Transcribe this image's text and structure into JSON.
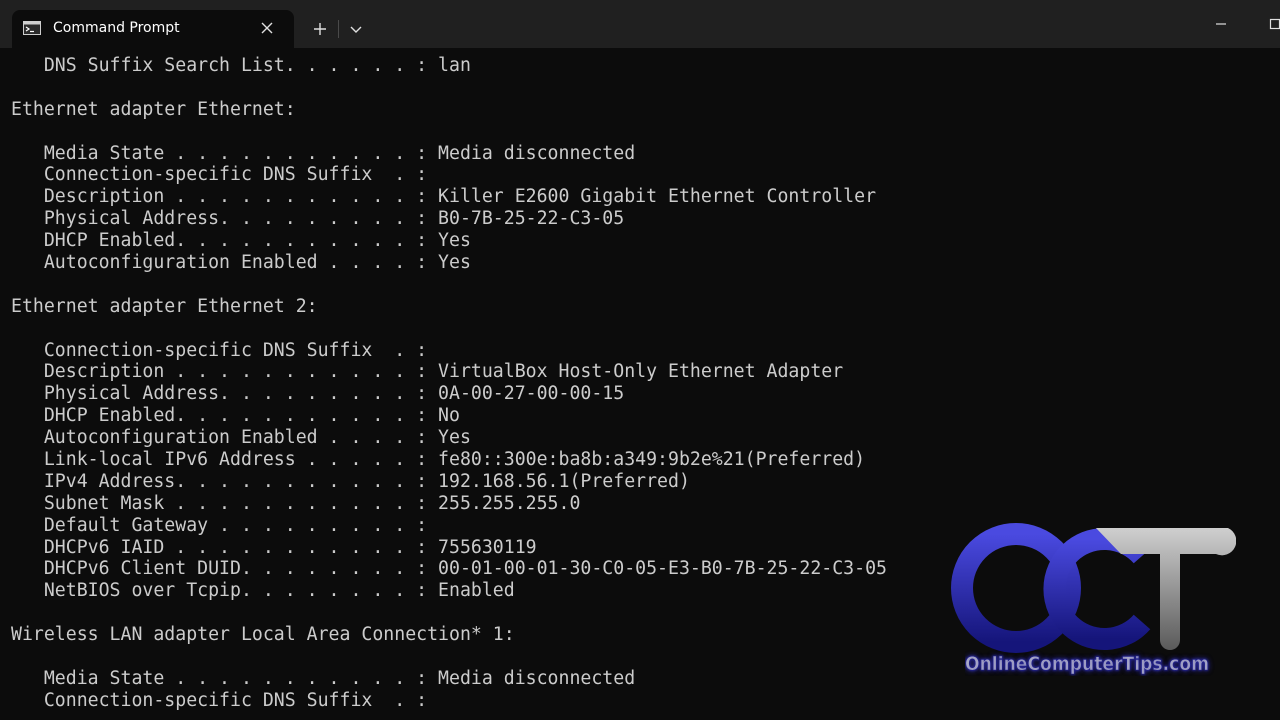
{
  "window": {
    "tab_title": "Command Prompt",
    "tab_icon": "terminal-icon",
    "close_icon": "close-icon",
    "new_tab_icon": "plus-icon",
    "dropdown_icon": "chevron-down-icon",
    "minimize_icon": "minimize-icon",
    "maximize_icon": "maximize-icon"
  },
  "console": {
    "lines": [
      "   DNS Suffix Search List. . . . . . : lan",
      "",
      "Ethernet adapter Ethernet:",
      "",
      "   Media State . . . . . . . . . . . : Media disconnected",
      "   Connection-specific DNS Suffix  . :",
      "   Description . . . . . . . . . . . : Killer E2600 Gigabit Ethernet Controller",
      "   Physical Address. . . . . . . . . : B0-7B-25-22-C3-05",
      "   DHCP Enabled. . . . . . . . . . . : Yes",
      "   Autoconfiguration Enabled . . . . : Yes",
      "",
      "Ethernet adapter Ethernet 2:",
      "",
      "   Connection-specific DNS Suffix  . :",
      "   Description . . . . . . . . . . . : VirtualBox Host-Only Ethernet Adapter",
      "   Physical Address. . . . . . . . . : 0A-00-27-00-00-15",
      "   DHCP Enabled. . . . . . . . . . . : No",
      "   Autoconfiguration Enabled . . . . : Yes",
      "   Link-local IPv6 Address . . . . . : fe80::300e:ba8b:a349:9b2e%21(Preferred)",
      "   IPv4 Address. . . . . . . . . . . : 192.168.56.1(Preferred)",
      "   Subnet Mask . . . . . . . . . . . : 255.255.255.0",
      "   Default Gateway . . . . . . . . . :",
      "   DHCPv6 IAID . . . . . . . . . . . : 755630119",
      "   DHCPv6 Client DUID. . . . . . . . : 00-01-00-01-30-C0-05-E3-B0-7B-25-22-C3-05",
      "   NetBIOS over Tcpip. . . . . . . . : Enabled",
      "",
      "Wireless LAN adapter Local Area Connection* 1:",
      "",
      "   Media State . . . . . . . . . . . : Media disconnected",
      "   Connection-specific DNS Suffix  . :"
    ]
  },
  "watermark": {
    "logo_letters": "OCT",
    "logo_text": "OnlineComputerTips.com",
    "colors": {
      "blue": "#2a2ab8",
      "gray": "#9a9a9a"
    }
  },
  "colors": {
    "titlebar": "#202020",
    "console_bg": "#0c0c0c",
    "console_text": "#cccccc"
  }
}
